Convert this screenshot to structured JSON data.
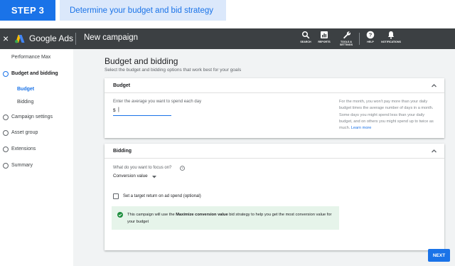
{
  "banner": {
    "step": "STEP 3",
    "title": "Determine your budget and bid strategy"
  },
  "appbar": {
    "close": "×",
    "product": "Google Ads",
    "campaign": "New campaign",
    "tools": [
      {
        "icon": "search-icon",
        "label": "SEARCH"
      },
      {
        "icon": "reports-icon",
        "label": "REPORTS"
      },
      {
        "icon": "wrench-icon",
        "label": "TOOLS & SETTINGS"
      },
      {
        "icon": "help-icon",
        "label": "HELP"
      },
      {
        "icon": "bell-icon",
        "label": "NOTIFICATIONS"
      }
    ]
  },
  "sidebar": {
    "campaign_type": "Performance Max",
    "items": [
      {
        "label": "Budget and bidding",
        "state": "active"
      },
      {
        "label": "Budget",
        "state": "sub-active"
      },
      {
        "label": "Bidding",
        "state": "sub"
      },
      {
        "label": "Campaign settings",
        "state": "normal"
      },
      {
        "label": "Asset group",
        "state": "normal"
      },
      {
        "label": "Extensions",
        "state": "normal"
      },
      {
        "label": "Summary",
        "state": "normal"
      }
    ]
  },
  "main": {
    "title": "Budget and bidding",
    "subtitle": "Select the budget and bidding options that work best for your goals",
    "budget": {
      "title": "Budget",
      "field_label": "Enter the average you want to spend each day",
      "currency": "$",
      "value": "",
      "help": "For the month, you won't pay more than your daily budget times the average number of days in a month. Some days you might spend less than your daily budget, and on others you might spend up to twice as much.",
      "learn_more": "Learn more"
    },
    "bidding": {
      "title": "Bidding",
      "focus_label": "What do you want to focus on?",
      "focus_value": "Conversion value",
      "target_label": "Set a target return on ad spend (optional)",
      "info_prefix": "This campaign will use the ",
      "info_bold": "Maximize conversion value",
      "info_suffix": " bid strategy to help you get the most conversion value for your budget"
    },
    "next": "NEXT"
  },
  "colors": {
    "accent": "#1a73e8",
    "appbar": "#3c4043",
    "info_bg": "#e6f4ea",
    "success": "#1e8e3e"
  }
}
